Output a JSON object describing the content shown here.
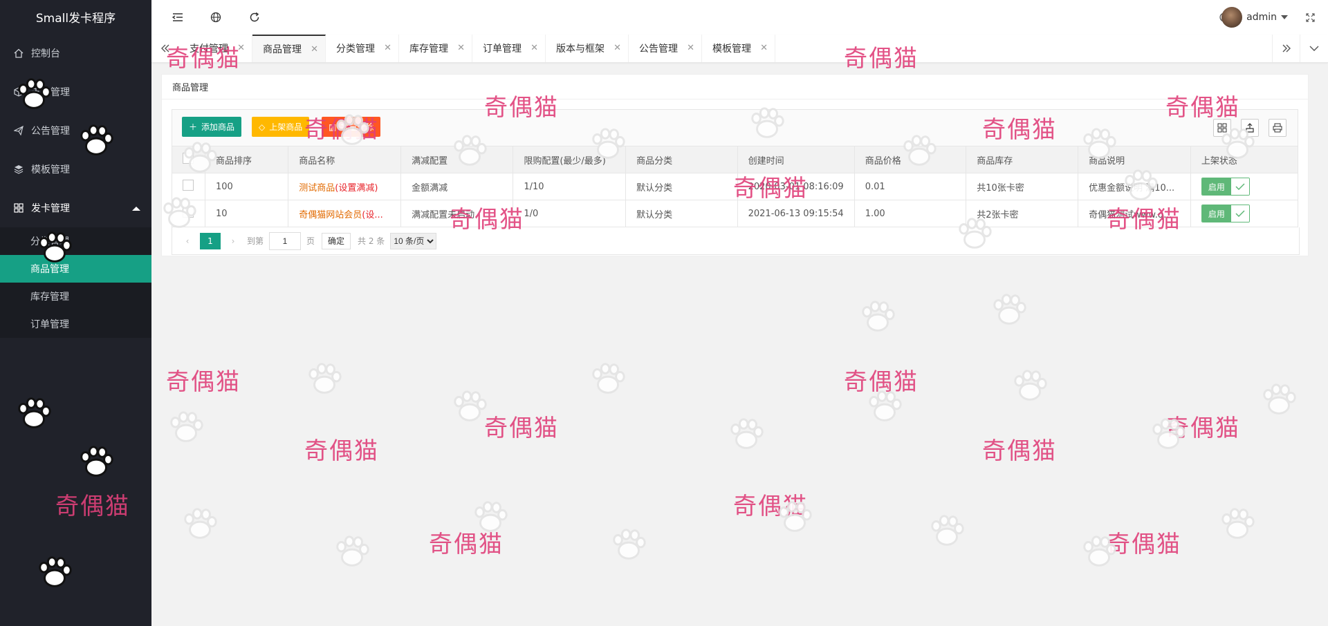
{
  "app": {
    "title": "Small发卡程序"
  },
  "sidebar": {
    "items": [
      {
        "label": "控制台",
        "icon": "home-icon"
      },
      {
        "label": "支付管理",
        "icon": "cube-icon"
      },
      {
        "label": "公告管理",
        "icon": "send-icon"
      },
      {
        "label": "模板管理",
        "icon": "layers-icon"
      },
      {
        "label": "发卡管理",
        "icon": "apps-icon"
      }
    ],
    "submenu": [
      {
        "label": "分类管理"
      },
      {
        "label": "商品管理",
        "active": true
      },
      {
        "label": "库存管理"
      },
      {
        "label": "订单管理"
      }
    ]
  },
  "header": {
    "user": "admin"
  },
  "tabs": [
    {
      "label": "支付管理"
    },
    {
      "label": "商品管理",
      "active": true
    },
    {
      "label": "分类管理"
    },
    {
      "label": "库存管理"
    },
    {
      "label": "订单管理"
    },
    {
      "label": "版本与框架"
    },
    {
      "label": "公告管理"
    },
    {
      "label": "模板管理"
    }
  ],
  "panel": {
    "title": "商品管理",
    "buttons": {
      "add": "添加商品",
      "shelf": "上架商品",
      "delete": "批量删除"
    },
    "columns": [
      "商品排序",
      "商品名称",
      "满减配置",
      "限购配置(最少/最多)",
      "商品分类",
      "创建时间",
      "商品价格",
      "商品库存",
      "商品说明",
      "上架状态"
    ],
    "rows": [
      {
        "sort": "100",
        "name": "测试商品",
        "name_suffix": "(设置满减)",
        "discount": "金额满减",
        "limit": "1/10",
        "category": "默认分类",
        "created": "2020-03-01 08:16:09",
        "price": "0.01",
        "stock": "共10张卡密",
        "desc": "优惠金额说明 满10...",
        "status": "启用"
      },
      {
        "sort": "10",
        "name": "奇偶猫网站会员",
        "name_suffix": "(设...",
        "discount": "满减配置未启动",
        "limit": "1/0",
        "category": "默认分类",
        "created": "2021-06-13 09:15:54",
        "price": "1.00",
        "stock": "共2张卡密",
        "desc": "奇偶猫测试www.q...",
        "status": "启用"
      }
    ],
    "pager": {
      "current": "1",
      "goto_label": "到第",
      "page_input": "1",
      "page_unit": "页",
      "confirm": "确定",
      "total": "共 2 条",
      "page_size": "10 条/页"
    }
  },
  "watermark": {
    "text": "奇偶猫"
  },
  "colors": {
    "sidebar": "#20222a",
    "accent": "#16a085",
    "warn": "#ffb800",
    "danger": "#ff5722",
    "switch": "#5fb878"
  }
}
